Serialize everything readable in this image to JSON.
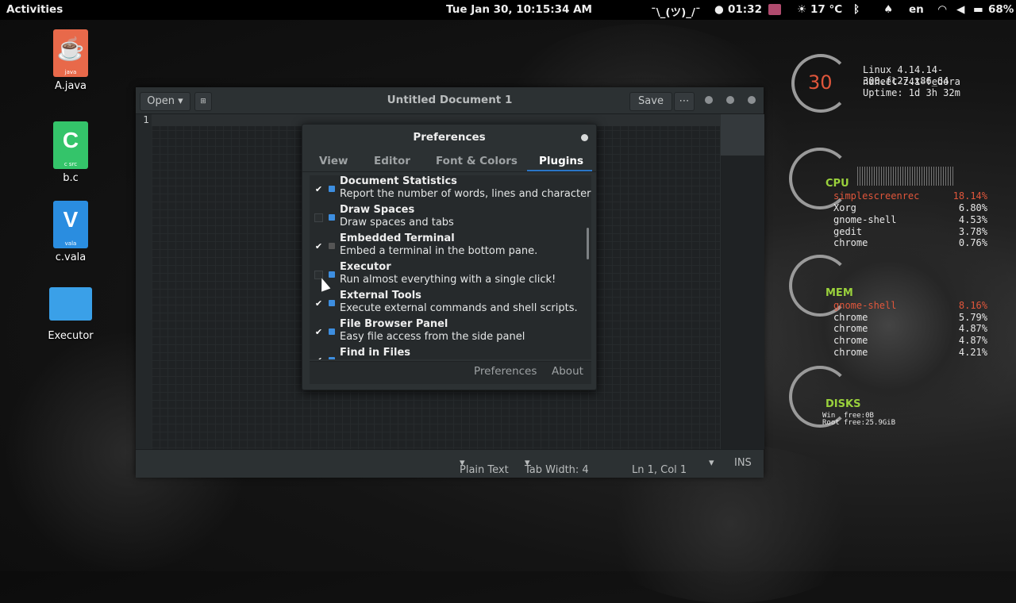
{
  "topbar": {
    "activities": "Activities",
    "clock": "Tue Jan 30, 10:15:34 AM",
    "shrug": "¯\\_(ツ)_/¯",
    "timer": "01:32",
    "weather": "17 °C",
    "lang": "en",
    "battery": "68%"
  },
  "desktop": [
    {
      "label": "A.java",
      "ext": "java",
      "glyph": "☕",
      "color": "#e8694a"
    },
    {
      "label": "b.c",
      "ext": "c src",
      "glyph": "C",
      "color": "#34c46a"
    },
    {
      "label": "c.vala",
      "ext": "vala",
      "glyph": "V",
      "color": "#2a8de0"
    },
    {
      "label": "Executor",
      "ext": "",
      "glyph": "",
      "color": "#3aa0e8"
    }
  ],
  "gedit": {
    "open": "Open",
    "title": "Untitled Document 1",
    "save": "Save",
    "line_number": "1",
    "status": {
      "lang": "Plain Text",
      "tab_width": "Tab Width: 4",
      "pos": "Ln 1, Col 1",
      "mode": "INS"
    }
  },
  "prefs": {
    "title": "Preferences",
    "tabs": [
      "View",
      "Editor",
      "Font & Colors",
      "Plugins"
    ],
    "plugins": [
      {
        "name": "Document Statistics",
        "desc": "Report the number of words, lines and characters…",
        "enabled": true
      },
      {
        "name": "Draw Spaces",
        "desc": "Draw spaces and tabs",
        "enabled": false
      },
      {
        "name": "Embedded Terminal",
        "desc": "Embed a terminal in the bottom pane.",
        "enabled": true
      },
      {
        "name": "Executor",
        "desc": "Run almost everything with a single click!",
        "enabled": false
      },
      {
        "name": "External Tools",
        "desc": "Execute external commands and shell scripts.",
        "enabled": true
      },
      {
        "name": "File Browser Panel",
        "desc": "Easy file access from the side panel",
        "enabled": true
      },
      {
        "name": "Find in Files",
        "desc": "",
        "enabled": true
      }
    ],
    "buttons": {
      "preferences": "Preferences",
      "about": "About"
    }
  },
  "conky": {
    "day": "30",
    "sys": [
      "Linux 4.14.14-300.fc27.x86_64",
      "naheel-z41-fedora",
      "Uptime: 1d 3h 32m"
    ],
    "cpu_label": "CPU",
    "cpu": [
      {
        "name": "simplescreenrec",
        "pct": "18.14%"
      },
      {
        "name": "Xorg",
        "pct": "6.80%"
      },
      {
        "name": "gnome-shell",
        "pct": "4.53%"
      },
      {
        "name": "gedit",
        "pct": "3.78%"
      },
      {
        "name": "chrome",
        "pct": "0.76%"
      }
    ],
    "mem_label": "MEM",
    "mem": [
      {
        "name": "gnome-shell",
        "pct": "8.16%"
      },
      {
        "name": "chrome",
        "pct": "5.79%"
      },
      {
        "name": "chrome",
        "pct": "4.87%"
      },
      {
        "name": "chrome",
        "pct": "4.87%"
      },
      {
        "name": "chrome",
        "pct": "4.21%"
      }
    ],
    "disks_label": "DISKS",
    "disk_win": "Win",
    "disk_root": "Root",
    "disk_win_free": "free:0B",
    "disk_root_free": "free:25.9GiB"
  }
}
